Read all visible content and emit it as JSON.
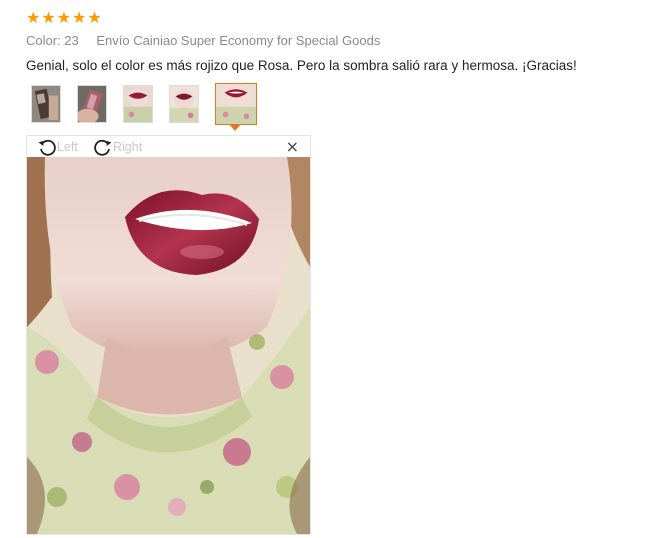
{
  "review": {
    "rating": 5,
    "stars": [
      "★",
      "★",
      "★",
      "★",
      "★"
    ],
    "color_label": "Color: 23",
    "shipping": "Envío Cainiao Super Economy for Special Goods",
    "text": "Genial, solo el color es más rojizo que Rosa. Pero la sombra salió rara y hermosa. ¡Gracias!"
  },
  "thumbnails": [
    {
      "name": "product-tube-photo"
    },
    {
      "name": "product-hand-photo"
    },
    {
      "name": "lips-photo-1"
    },
    {
      "name": "lips-photo-2"
    },
    {
      "name": "lips-photo-3",
      "selected": true
    }
  ],
  "viewer": {
    "rotate_left_label": "Left",
    "rotate_right_label": "Right",
    "close_symbol": "×"
  },
  "colors": {
    "star": "#ff9900",
    "accent": "#e07a1f",
    "lip": "#9b1733"
  }
}
